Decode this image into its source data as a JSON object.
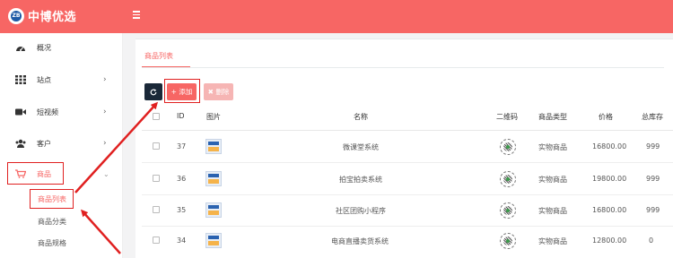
{
  "header": {
    "brand_name": "中博优选",
    "brand_logo_text": "ZB"
  },
  "sidebar": {
    "items": [
      {
        "label": "概况",
        "icon": "dashboard-icon",
        "has_chevron": false
      },
      {
        "label": "站点",
        "icon": "grid-icon",
        "chevron": "›"
      },
      {
        "label": "短视频",
        "icon": "video-icon",
        "chevron": "›"
      },
      {
        "label": "客户",
        "icon": "users-icon",
        "chevron": "›"
      },
      {
        "label": "商品",
        "icon": "cart-icon",
        "chevron": "⌄"
      }
    ],
    "sub_items": [
      {
        "label": "商品列表",
        "active": true
      },
      {
        "label": "商品分类"
      },
      {
        "label": "商品规格"
      }
    ]
  },
  "tabs": [
    {
      "label": "商品列表"
    }
  ],
  "toolbar": {
    "refresh_icon": "refresh-icon",
    "add_label": "+ 添加",
    "delete_label": "✖ 删除"
  },
  "table": {
    "columns": [
      "ID",
      "图片",
      "名称",
      "二维码",
      "商品类型",
      "价格",
      "总库存"
    ],
    "rows": [
      {
        "id": "37",
        "name": "微课堂系统",
        "type": "实物商品",
        "price": "16800.00",
        "stock": "999"
      },
      {
        "id": "36",
        "name": "拍宝拍卖系统",
        "type": "实物商品",
        "price": "19800.00",
        "stock": "999"
      },
      {
        "id": "35",
        "name": "社区团购小程序",
        "type": "实物商品",
        "price": "16800.00",
        "stock": "999"
      },
      {
        "id": "34",
        "name": "电商直播卖货系统",
        "type": "实物商品",
        "price": "12800.00",
        "stock": "0"
      }
    ]
  },
  "colors": {
    "brand": "#f76664",
    "annotation": "#e02020",
    "dark_button": "#1a2838"
  }
}
